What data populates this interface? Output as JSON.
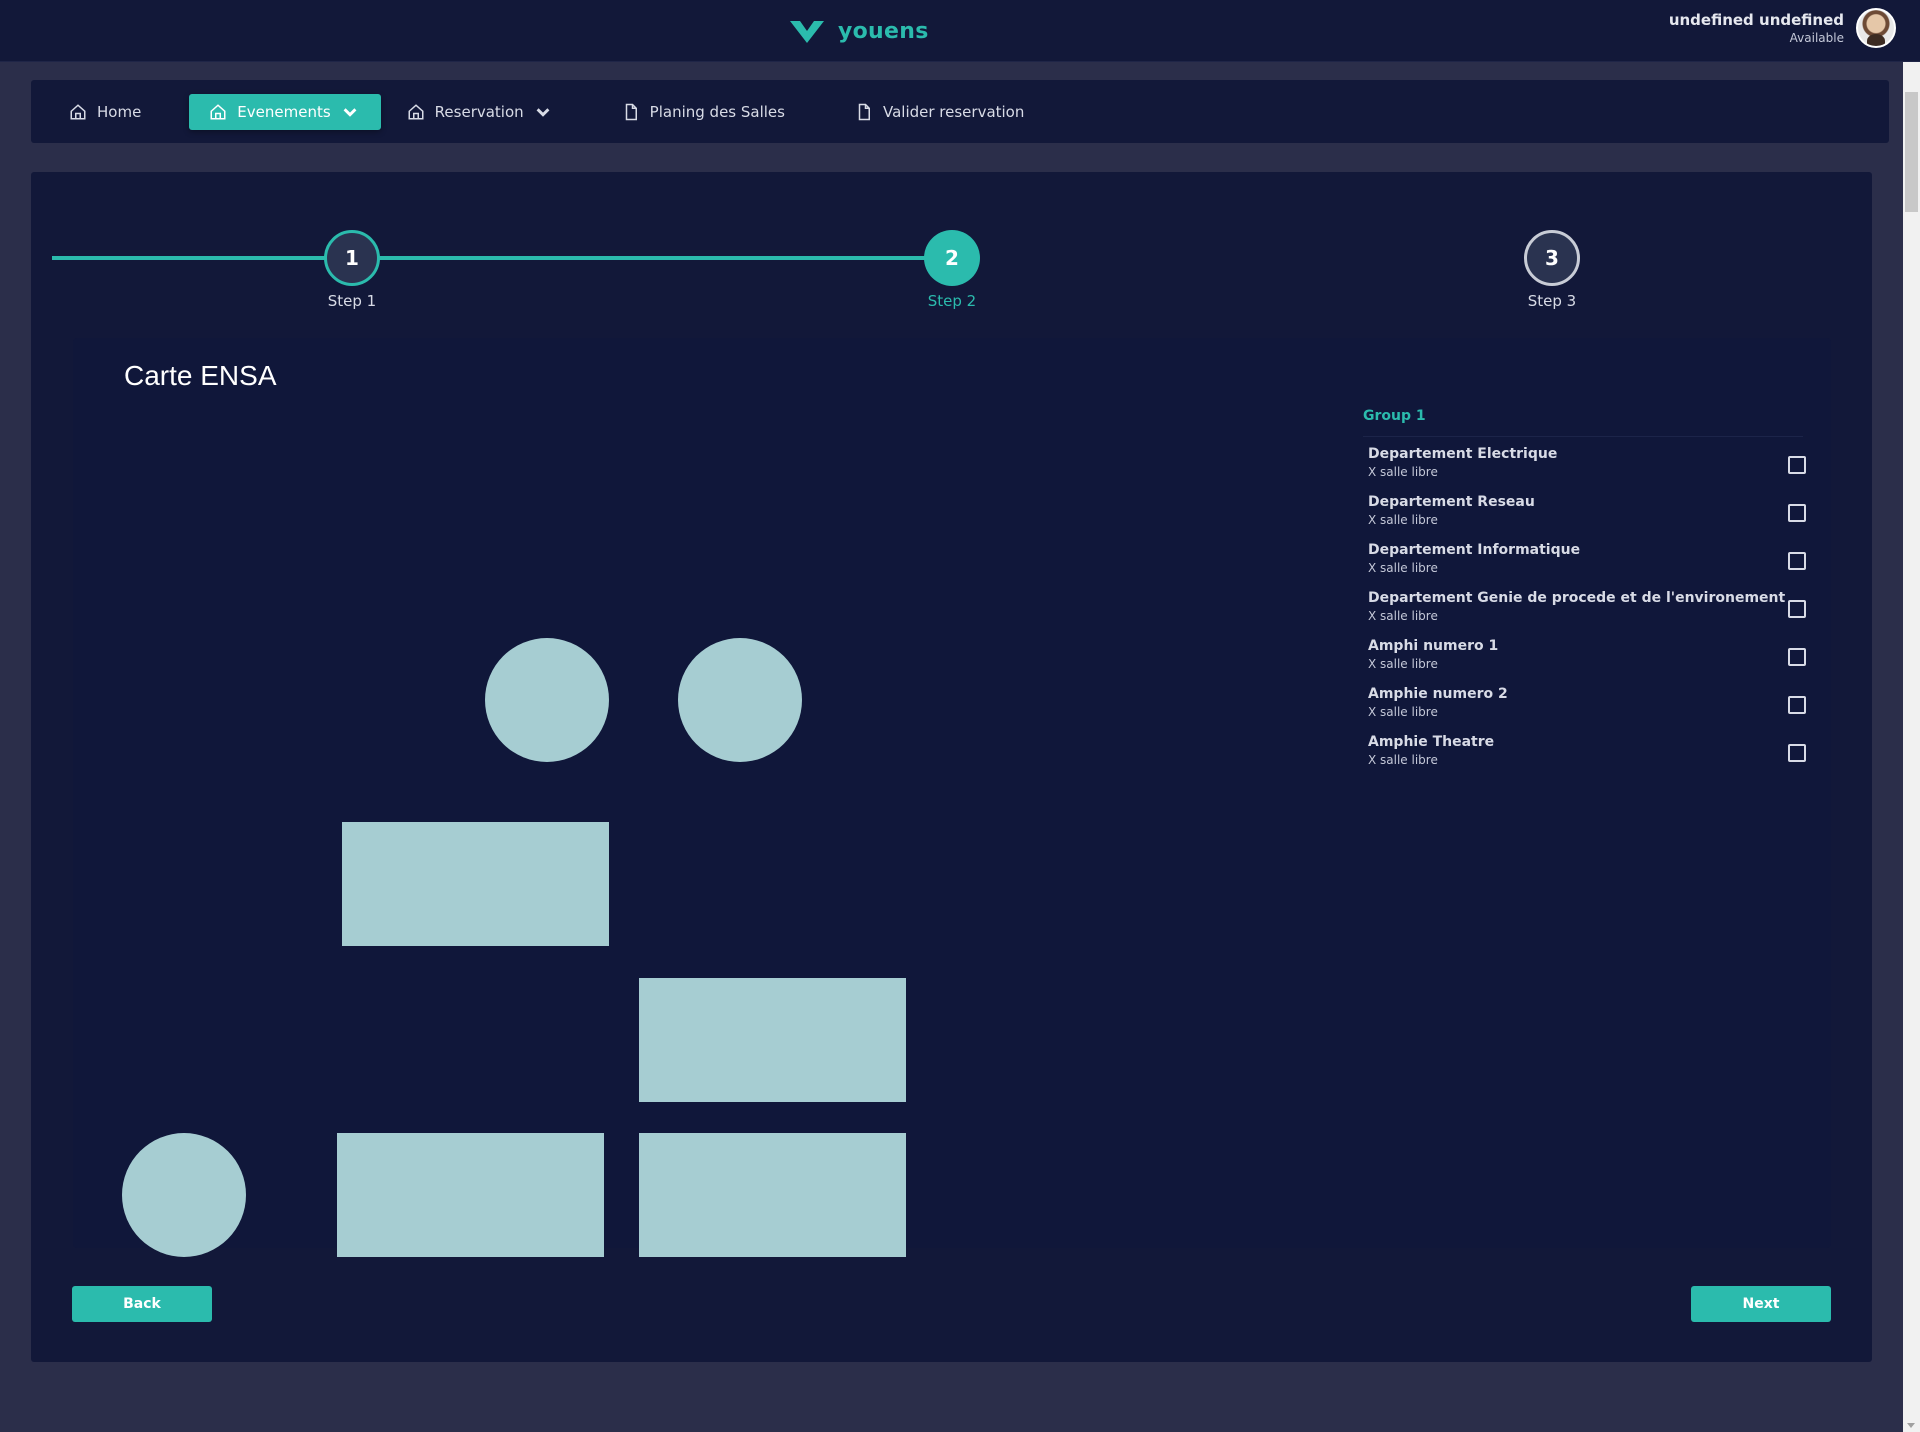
{
  "app": {
    "brand_name": "youens",
    "accent_color": "#2bbbad"
  },
  "user": {
    "name": "undefined undefined",
    "status": "Available"
  },
  "nav": {
    "items": [
      {
        "label": "Home",
        "icon": "home-icon"
      },
      {
        "label": "Evenements",
        "icon": "home-icon",
        "active": true,
        "dropdown": true
      },
      {
        "label": "Reservation",
        "icon": "home-icon",
        "dropdown": true
      },
      {
        "label": "Planing des Salles",
        "icon": "document-icon"
      },
      {
        "label": "Valider reservation",
        "icon": "document-icon"
      }
    ]
  },
  "stepper": {
    "steps": [
      {
        "number": "1",
        "label": "Step 1",
        "state": "done"
      },
      {
        "number": "2",
        "label": "Step 2",
        "state": "current"
      },
      {
        "number": "3",
        "label": "Step 3",
        "state": "todo"
      }
    ]
  },
  "map": {
    "title": "Carte ENSA",
    "shape_color": "#a6cdd2"
  },
  "rooms": {
    "group_title": "Group 1",
    "items": [
      {
        "name": "Departement Electrique",
        "sub": "X salle libre",
        "checked": false
      },
      {
        "name": "Departement Reseau",
        "sub": "X salle libre",
        "checked": false
      },
      {
        "name": "Departement Informatique",
        "sub": "X salle libre",
        "checked": false
      },
      {
        "name": "Departement Genie de procede et de l'environement",
        "sub": "X salle libre",
        "checked": false
      },
      {
        "name": "Amphi numero 1",
        "sub": "X salle libre",
        "checked": false
      },
      {
        "name": "Amphie numero 2",
        "sub": "X salle libre",
        "checked": false
      },
      {
        "name": "Amphie Theatre",
        "sub": "X salle libre",
        "checked": false
      }
    ]
  },
  "actions": {
    "back_label": "Back",
    "next_label": "Next"
  }
}
